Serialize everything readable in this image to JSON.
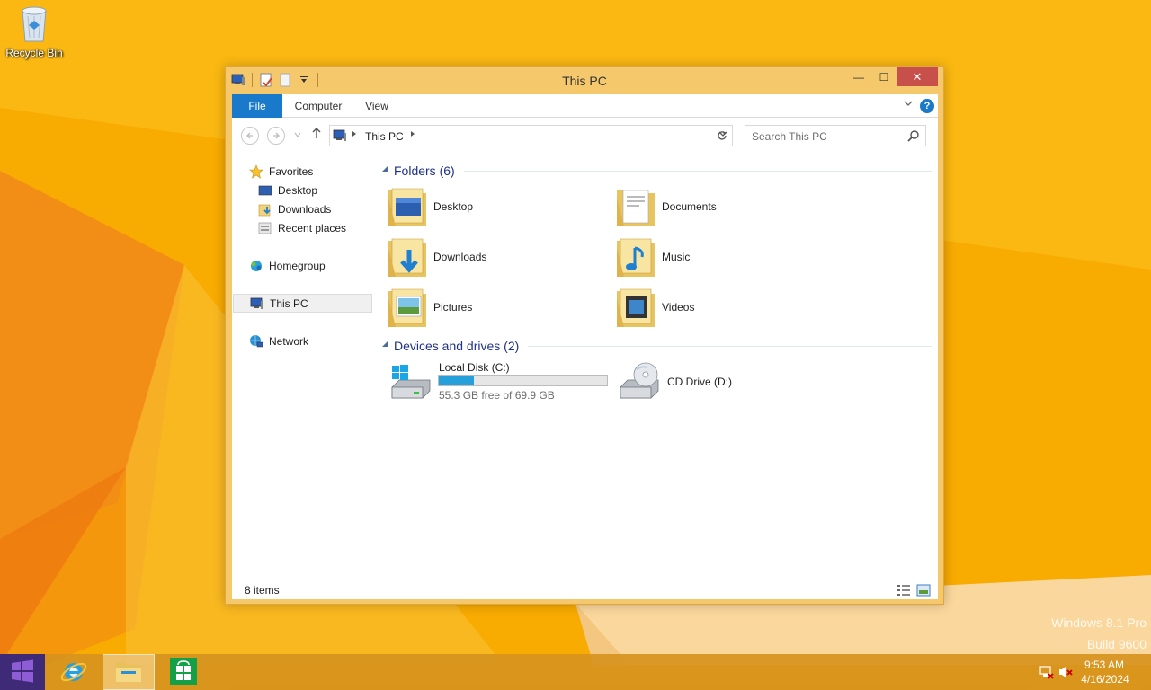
{
  "desktop": {
    "recycle_bin_label": "Recycle Bin",
    "watermark_line1": "Windows 8.1 Pro",
    "watermark_line2": "Build 9600"
  },
  "window": {
    "title": "This PC",
    "controls": {
      "minimize": "—",
      "maximize": "☐",
      "close": "✕"
    }
  },
  "ribbon": {
    "tabs": [
      "File",
      "Computer",
      "View"
    ],
    "help": "?"
  },
  "address_bar": {
    "crumb": "This PC",
    "search_placeholder": "Search This PC"
  },
  "nav_pane": {
    "favorites": "Favorites",
    "favorites_items": [
      "Desktop",
      "Downloads",
      "Recent places"
    ],
    "homegroup": "Homegroup",
    "this_pc": "This PC",
    "network": "Network"
  },
  "content": {
    "folders_header": "Folders (6)",
    "folders": [
      "Desktop",
      "Documents",
      "Downloads",
      "Music",
      "Pictures",
      "Videos"
    ],
    "drives_header": "Devices and drives (2)",
    "drives": [
      {
        "name": "Local Disk (C:)",
        "free_text": "55.3 GB free of 69.9 GB",
        "used_fraction": 0.21
      },
      {
        "name": "CD Drive (D:)"
      }
    ]
  },
  "status_bar": {
    "item_count": "8 items"
  },
  "taskbar": {
    "time": "9:53 AM",
    "date": "4/16/2024"
  },
  "colors": {
    "accent": "#1979ca",
    "wallpaper": "#f7a800",
    "close_button": "#c7504b",
    "progress": "#26a0da"
  }
}
